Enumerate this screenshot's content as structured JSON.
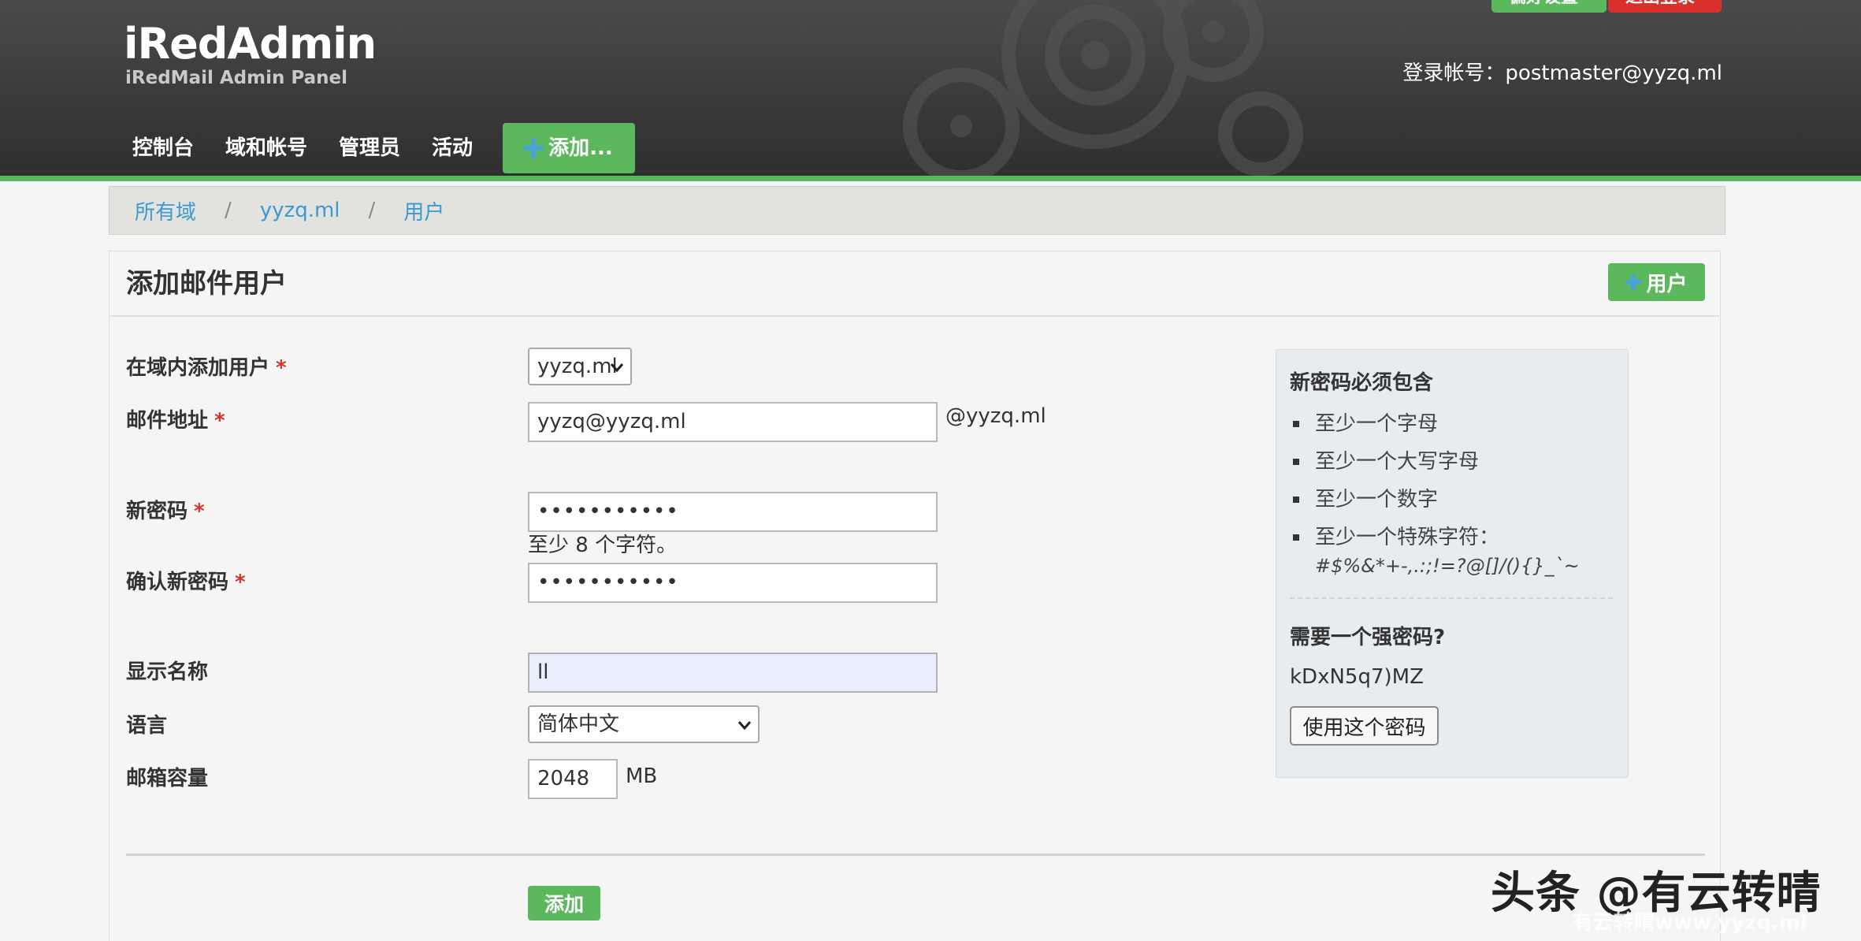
{
  "header": {
    "app_title": "iRedAdmin",
    "app_subtitle": "iRedMail Admin Panel",
    "preferences_label": "偏好设置",
    "logout_label": "退出登录",
    "login_info": "登录帐号：postmaster@yyzq.ml",
    "nav": {
      "dashboard": "控制台",
      "domains_accounts": "域和帐号",
      "admins": "管理员",
      "activities": "活动",
      "add": "添加..."
    },
    "colors": {
      "accent": "#5cb85c",
      "danger": "#d9302c",
      "link": "#3c9ad1"
    }
  },
  "breadcrumb": {
    "all_domains": "所有域",
    "domain": "yyzq.ml",
    "users": "用户",
    "separator": "/"
  },
  "panel": {
    "title": "添加邮件用户",
    "add_user_button": "用户"
  },
  "form": {
    "domain_label": "在域内添加用户",
    "domain_value": "yyzq.ml",
    "email_label": "邮件地址",
    "email_value": "yyzq@yyzq.ml",
    "email_suffix": "@yyzq.ml",
    "password_label": "新密码",
    "password_value": "•••••••••••",
    "password_hint": "至少 8 个字符。",
    "confirm_label": "确认新密码",
    "confirm_value": "•••••••••••",
    "display_name_label": "显示名称",
    "display_name_value": "ll",
    "language_label": "语言",
    "language_value": "简体中文",
    "quota_label": "邮箱容量",
    "quota_value": "2048",
    "quota_unit": "MB",
    "required_mark": "*",
    "submit_label": "添加"
  },
  "password_rules": {
    "title": "新密码必须包含",
    "items": [
      "至少一个字母",
      "至少一个大写字母",
      "至少一个数字",
      "至少一个特殊字符："
    ],
    "special_chars": "#$%&*+-,.:;!=?@[]/(){}_`~",
    "strong_title": "需要一个强密码?",
    "generated": "kDxN5q7)MZ",
    "use_button": "使用这个密码"
  },
  "watermark": {
    "text": "头条 @有云转晴",
    "sub": "有云转晴www.yyzq.ml"
  }
}
